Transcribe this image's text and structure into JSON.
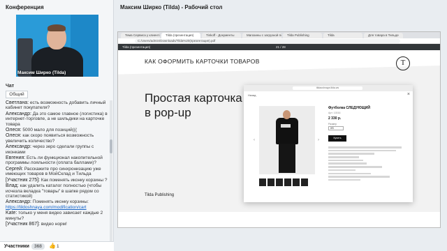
{
  "left": {
    "conference_title": "Конференция",
    "speaker_name": "Максим Ширко (Tilda)",
    "chat_title": "Чат",
    "chat_tab": "Общий",
    "messages": [
      {
        "author": "Светлана:",
        "text": "есть возможность добавить личный кабинет покупателя?"
      },
      {
        "author": "Александр:",
        "text": "Да это самое главное (логистика) в интернет-торговле, а не шильдики на карточке товара"
      },
      {
        "author": "Олеся:",
        "text": "5000 мало для позиций((("
      },
      {
        "author": "Олеся:",
        "text": "как скоро появиться возможность увеличить количество?"
      },
      {
        "author": "Александр:",
        "text": "через зеро сделали группы с иконками"
      },
      {
        "author": "Евгения:",
        "text": "Есть ли функционал накопительной программы лояльности (оплата баллами)?"
      },
      {
        "author": "Сергей:",
        "text": "Расскажите про синхронизацию уже имеющих товаров в МойСклад и Тильда"
      },
      {
        "author": "[Участник 275]:",
        "text": "Как поменять иконку корзины ?"
      },
      {
        "author": "Влад:",
        "text": "как удалить каталог полностью (чтобы исчезла вкладка \"товары\" в шапке рядом со статистикой)"
      },
      {
        "author": "Александр:",
        "text": "Поменять иконку корзины:",
        "link": "https://tildoshnaya.com/modification/cart"
      },
      {
        "author": "Kate:",
        "text": "только у меня видео зависает каждые 2 минуты?"
      },
      {
        "author": "[Участник 867]:",
        "text": "видео норм!"
      }
    ],
    "participants_label": "Участники",
    "participants_count": "368",
    "participants_icon": "thumbs-up-icon",
    "likes_count": "1"
  },
  "right": {
    "window_title": "Максим Ширко (Tilda) - Рабочий стол",
    "tabs": [
      "Тема Сервиса у клиентов Tild",
      "Tilda (презентация)",
      "Tinkoff - Документы",
      "Магазины с загрузкой по",
      "Tilda Publishing",
      "Tilda",
      "Для товара в Тильде"
    ],
    "url": "C:/Users/admin/Downloads/Tilda%20(презентация).pdf",
    "pdf_title": "Tilda (презентация)",
    "pdf_page": "21 / 28",
    "slide_heading": "КАК ОФОРМИТЬ КАРТОЧКИ ТОВАРОВ",
    "slide_big_line1": "Простая карточка",
    "slide_big_line2": "в pop-up",
    "slide_footer": "Tilda Publishing",
    "logo_letter": "T",
    "popup": {
      "url": "tildaoshnaya.tilda.ws",
      "back": "Назад",
      "product_title": "Футболка СЛЕДУЮЩИЙ",
      "sku": "Арт: 10016",
      "price": "2 330 р.",
      "size_label": "Размер",
      "size_value": "XS",
      "buy": "Купить"
    }
  }
}
